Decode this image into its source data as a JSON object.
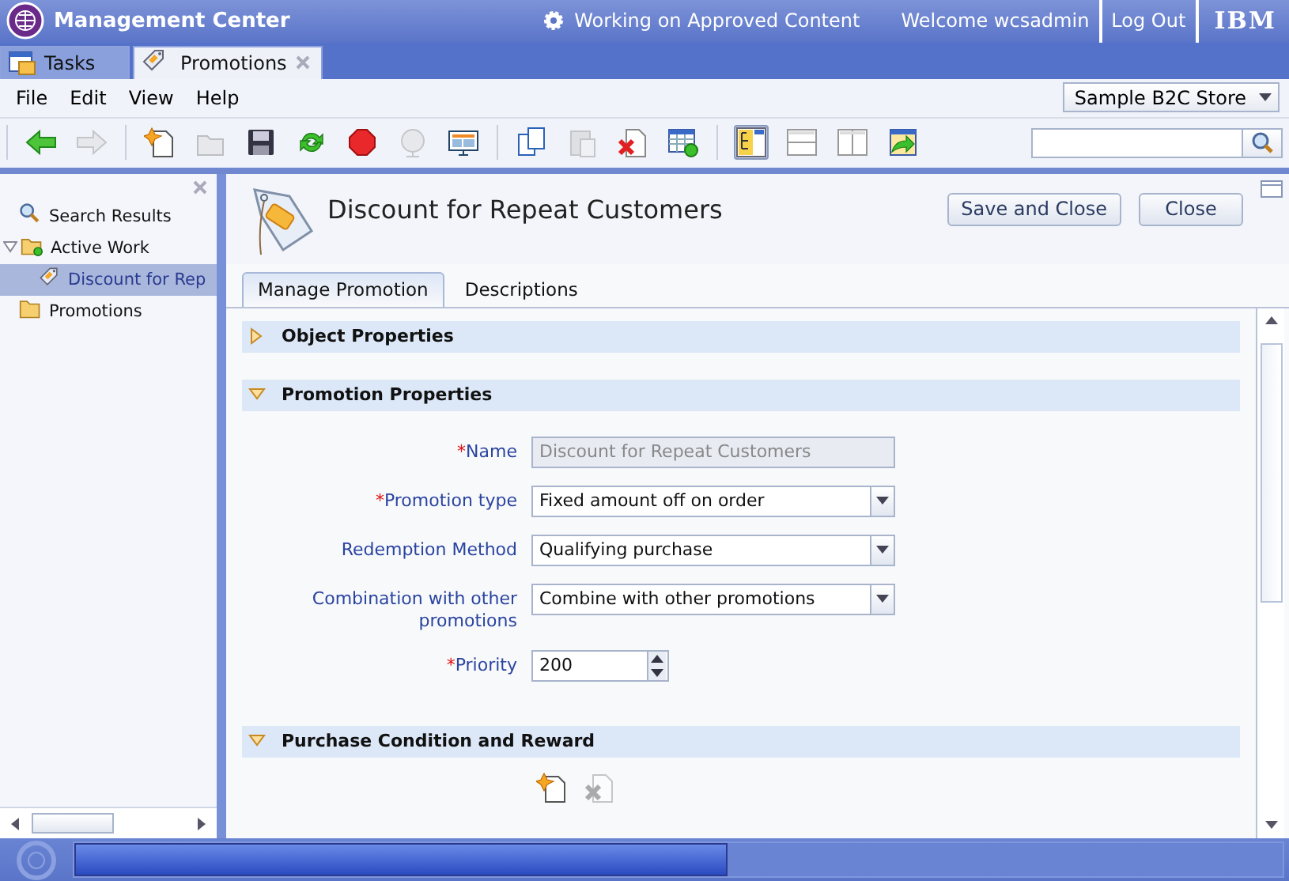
{
  "header": {
    "title": "Management Center",
    "status": "Working on Approved Content",
    "welcome": "Welcome wcsadmin",
    "logout": "Log Out",
    "brand": "IBM"
  },
  "app_tabs": [
    {
      "label": "Tasks",
      "selected": false,
      "closable": false
    },
    {
      "label": "Promotions",
      "selected": true,
      "closable": true
    }
  ],
  "menu": [
    "File",
    "Edit",
    "View",
    "Help"
  ],
  "store": {
    "value": "Sample B2C Store"
  },
  "toolbar": {
    "groups": [
      [
        {
          "kind": "back",
          "disabled": false
        },
        {
          "kind": "forward",
          "disabled": true
        }
      ],
      [
        {
          "kind": "new",
          "disabled": false
        },
        {
          "kind": "open",
          "disabled": true
        },
        {
          "kind": "save",
          "disabled": false
        },
        {
          "kind": "refresh",
          "disabled": false
        },
        {
          "kind": "stop",
          "disabled": false
        },
        {
          "kind": "globe",
          "disabled": true
        },
        {
          "kind": "preview",
          "disabled": false
        }
      ],
      [
        {
          "kind": "copy",
          "disabled": false
        },
        {
          "kind": "paste",
          "disabled": true
        },
        {
          "kind": "delete",
          "disabled": false
        },
        {
          "kind": "table",
          "disabled": false
        }
      ],
      [
        {
          "kind": "layout-tree",
          "disabled": false,
          "selected": true
        },
        {
          "kind": "layout-rows",
          "disabled": false,
          "selected": false
        },
        {
          "kind": "layout-columns",
          "disabled": false,
          "selected": false
        },
        {
          "kind": "export",
          "disabled": false,
          "selected": false
        }
      ]
    ]
  },
  "tree": {
    "items": [
      {
        "label": "Search Results",
        "kind": "search",
        "selected": false
      },
      {
        "label": "Active Work",
        "kind": "active-folder",
        "selected": false,
        "expanded": true,
        "children": [
          {
            "label": "Discount for Rep",
            "kind": "promotion",
            "selected": true
          }
        ]
      },
      {
        "label": "Promotions",
        "kind": "folder",
        "selected": false
      }
    ]
  },
  "editor": {
    "title": "Discount for Repeat Customers",
    "buttons": [
      "Save and Close",
      "Close"
    ],
    "tabs": [
      {
        "label": "Manage Promotion",
        "selected": true
      },
      {
        "label": "Descriptions",
        "selected": false
      }
    ],
    "sections": [
      {
        "title": "Object Properties",
        "expanded": false
      },
      {
        "title": "Promotion Properties",
        "expanded": true,
        "fields": [
          {
            "kind": "text",
            "required_mark": "*",
            "label": "Name",
            "disabled": true,
            "value": "Discount for Repeat Customers"
          },
          {
            "kind": "select",
            "required_mark": "*",
            "label": "Promotion type",
            "disabled": false,
            "value": "Fixed amount off on order"
          },
          {
            "kind": "select",
            "label": "Redemption Method",
            "disabled": false,
            "value": "Qualifying purchase"
          },
          {
            "kind": "select",
            "label": "Combination with other promotions",
            "disabled": false,
            "value": "Combine with other promotions"
          },
          {
            "kind": "spinner",
            "required_mark": "*",
            "label": "Priority",
            "disabled": false,
            "value": "200"
          }
        ]
      },
      {
        "title": "Purchase Condition and Reward",
        "expanded": true,
        "actions": [
          {
            "kind": "new",
            "disabled": false
          },
          {
            "kind": "delete",
            "disabled": true
          }
        ]
      }
    ]
  },
  "status_bar": {
    "progress": {
      "level": 0.54
    }
  }
}
